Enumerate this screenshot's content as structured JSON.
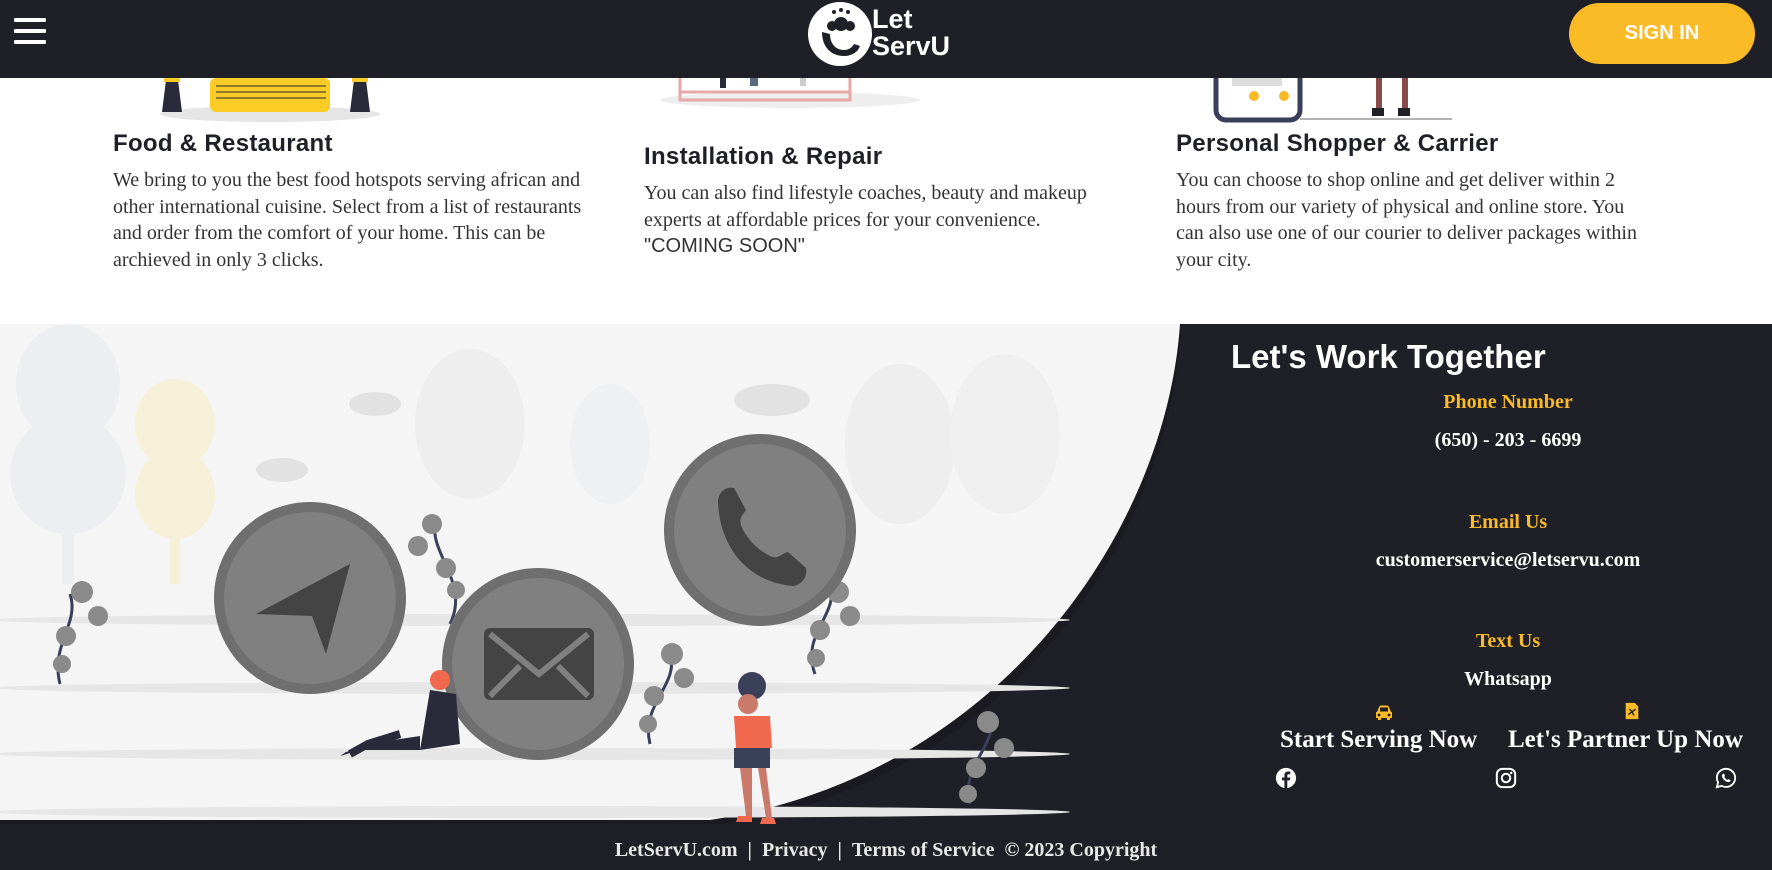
{
  "header": {
    "menu_icon": "hamburger-menu-icon",
    "logo_text_line1": "Let",
    "logo_text_line2": "ServU",
    "sign_in_label": "SIGN IN",
    "accent": "#fbbb26",
    "background": "#1f1f27"
  },
  "services": [
    {
      "title": "Food & Restaurant",
      "description": "We bring to you the best food hotspots serving african and other international cuisine. Select from a list of restaurants and order from the comfort of your home. This can be archieved in only 3 clicks."
    },
    {
      "title": "Installation & Repair",
      "description": "You can also find lifestyle coaches, beauty and makeup experts at affordable prices for your convenience.",
      "note": "\"COMING SOON\""
    },
    {
      "title": "Personal Shopper & Carrier",
      "description": "You can choose to shop online and get deliver within 2 hours from our variety of physical and online store. You can also use one of our courier to deliver packages within your city."
    }
  ],
  "contact": {
    "title": "Let's Work Together",
    "phone_label": "Phone Number",
    "phone_value": "(650) - 203 - 6699",
    "email_label": "Email Us",
    "email_value": "customerservice@letservu.com",
    "text_label": "Text Us",
    "text_value": "Whatsapp",
    "cta_serve": "Start Serving Now",
    "cta_serve_icon": "car-icon",
    "cta_partner": "Let's Partner Up Now",
    "cta_partner_icon": "document-icon",
    "social_icons": [
      "facebook-icon",
      "instagram-icon",
      "whatsapp-icon"
    ]
  },
  "footer": {
    "site": "LetServU.com",
    "privacy": "Privacy",
    "terms": "Terms of Service",
    "copyright": "© 2023 Copyright",
    "separator": "|"
  }
}
